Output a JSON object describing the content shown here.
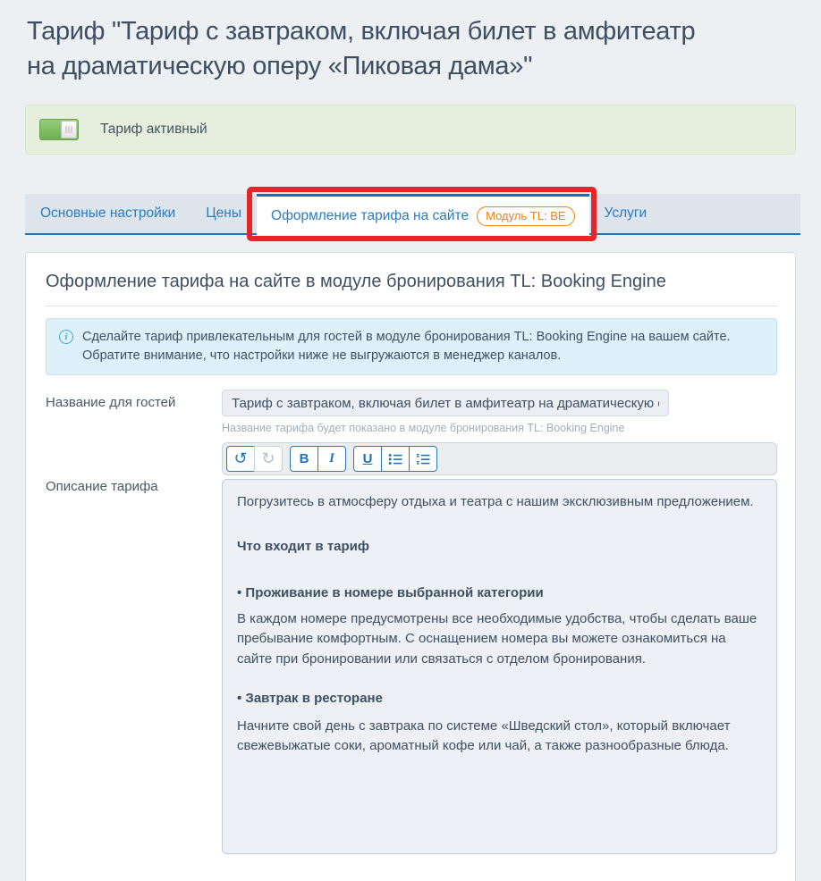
{
  "page_title": "Тариф \"Тариф с завтраком, включая билет в амфитеатр на драматическую оперу «Пиковая дама»\"",
  "status_banner": {
    "label": "Тариф активный",
    "toggle_state": "on"
  },
  "tabs": {
    "main_settings": {
      "label": "Основные настройки",
      "active": false
    },
    "prices": {
      "label": "Цены",
      "active": false
    },
    "site_appearance": {
      "label": "Оформление тарифа на сайте",
      "badge": "Модуль TL: BE",
      "active": true,
      "highlighted_with_red_box": true
    },
    "services": {
      "label": "Услуги",
      "active": false
    }
  },
  "panel": {
    "heading": "Оформление тарифа на сайте в модуле бронирования TL: Booking Engine",
    "info_lines": [
      "Сделайте тариф привлекательным для гостей в модуле бронирования TL: Booking Engine на вашем сайте.",
      "Обратите внимание, что настройки ниже не выгружаются в менеджер каналов."
    ]
  },
  "guest_name": {
    "label": "Название для гостей",
    "value": "Тариф с завтраком, включая билет в амфитеатр на драматическую с",
    "helper": "Название тарифа будет показано в модуле бронирования TL: Booking Engine"
  },
  "editor": {
    "label": "Описание тарифа",
    "toolbar": {
      "undo": "↺",
      "redo": "↻",
      "bold": "B",
      "italic": "I",
      "underline": "U",
      "unordered_list": "bullet-list-icon",
      "ordered_list": "numbered-list-icon",
      "redo_disabled": true
    },
    "paragraphs": [
      {
        "text": "Погрузитесь в атмосферу отдыха и театра с нашим эксклюзивным предложением.",
        "bold": false
      },
      {
        "text": "Что входит в тариф",
        "bold": true
      },
      {
        "text": "• Проживание в номере выбранной категории",
        "bold": true
      },
      {
        "text": "В каждом номере предусмотрены все необходимые удобства, чтобы сделать ваше пребывание комфортным. С оснащением номера вы можете ознакомиться на сайте при бронировании или связаться с отделом бронирования.",
        "bold": false
      },
      {
        "text": "• Завтрак в ресторане",
        "bold": true
      },
      {
        "text": "Начните свой день с завтрака по системе «Шведский стол», который включает свежевыжатые соки, ароматный кофе или чай, а также разнообразные блюда.",
        "bold": false
      }
    ]
  },
  "colors": {
    "page_background": "#edf0f3",
    "text": "#3e4f63",
    "accent_blue": "#1b75bb",
    "tab_link_blue": "#2b7cbd",
    "badge_orange": "#ee8208",
    "annotation_red": "#e52528",
    "toggle_green": "#7cba5e",
    "banner_background": "#e6efde",
    "info_background": "#def1fa",
    "input_background": "#ebeff3"
  }
}
